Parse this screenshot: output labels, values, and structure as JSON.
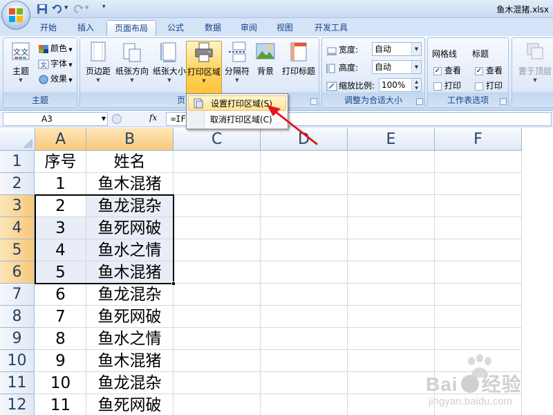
{
  "title_bar": {
    "document_title": "鱼木混猪.xlsx",
    "icons": [
      "office-logo-icon",
      "save-icon",
      "undo-icon",
      "redo-icon",
      "customize-qat-icon"
    ]
  },
  "tabs": [
    {
      "label": "开始",
      "active": false
    },
    {
      "label": "插入",
      "active": false
    },
    {
      "label": "页面布局",
      "active": true
    },
    {
      "label": "公式",
      "active": false
    },
    {
      "label": "数据",
      "active": false
    },
    {
      "label": "审阅",
      "active": false
    },
    {
      "label": "视图",
      "active": false
    },
    {
      "label": "开发工具",
      "active": false
    }
  ],
  "ribbon": {
    "theme_group": {
      "label": "主题",
      "theme_button": "主题",
      "colors": "颜色",
      "fonts": "字体",
      "effects": "效果"
    },
    "page_setup_group": {
      "label": "页",
      "margins": "页边距",
      "orientation": "纸张方向",
      "size": "纸张大小",
      "print_area": "打印区域",
      "breaks": "分隔符",
      "background": "背景",
      "print_titles": "打印标题"
    },
    "scale_group": {
      "label": "调整为合适大小",
      "width_label": "宽度:",
      "width_value": "自动",
      "height_label": "高度:",
      "height_value": "自动",
      "scale_label": "缩放比例:",
      "scale_value": "100%"
    },
    "sheet_options_group": {
      "label": "工作表选项",
      "gridlines_title": "网格线",
      "headings_title": "标题",
      "view": "查看",
      "print": "打印",
      "gridlines_view_checked": true,
      "gridlines_print_checked": false,
      "headings_view_checked": true,
      "headings_print_checked": false
    },
    "arrange_group": {
      "bring_forward": "置于顶层"
    }
  },
  "print_area_menu": {
    "items": [
      {
        "label": "设置打印区域(S)",
        "highlighted": true
      },
      {
        "label": "取消打印区域(C)",
        "highlighted": false
      }
    ]
  },
  "formula_bar": {
    "name_box": "A3",
    "fx": "fx",
    "formula": "=IF"
  },
  "sheet": {
    "columns": [
      "A",
      "B",
      "C",
      "D",
      "E",
      "F"
    ],
    "selected_columns": [
      "A",
      "B"
    ],
    "selected_rows": [
      3,
      4,
      5,
      6
    ],
    "rows": [
      {
        "num": "1",
        "a": "序号",
        "b": "姓名"
      },
      {
        "num": "2",
        "a": "1",
        "b": "鱼木混猪"
      },
      {
        "num": "3",
        "a": "2",
        "b": "鱼龙混杂"
      },
      {
        "num": "4",
        "a": "3",
        "b": "鱼死网破"
      },
      {
        "num": "5",
        "a": "4",
        "b": "鱼水之情"
      },
      {
        "num": "6",
        "a": "5",
        "b": "鱼木混猪"
      },
      {
        "num": "7",
        "a": "6",
        "b": "鱼龙混杂"
      },
      {
        "num": "8",
        "a": "7",
        "b": "鱼死网破"
      },
      {
        "num": "9",
        "a": "8",
        "b": "鱼水之情"
      },
      {
        "num": "10",
        "a": "9",
        "b": "鱼木混猪"
      },
      {
        "num": "11",
        "a": "10",
        "b": "鱼龙混杂"
      },
      {
        "num": "12",
        "a": "11",
        "b": "鱼死网破"
      }
    ]
  },
  "watermark": {
    "brand": "Bai",
    "brand2": "经验",
    "url": "jingyan.baidu.com"
  },
  "colors": {
    "accent_blue": "#15428b",
    "selected_header": "#f8c97b",
    "annotation_red": "#e8141c"
  }
}
